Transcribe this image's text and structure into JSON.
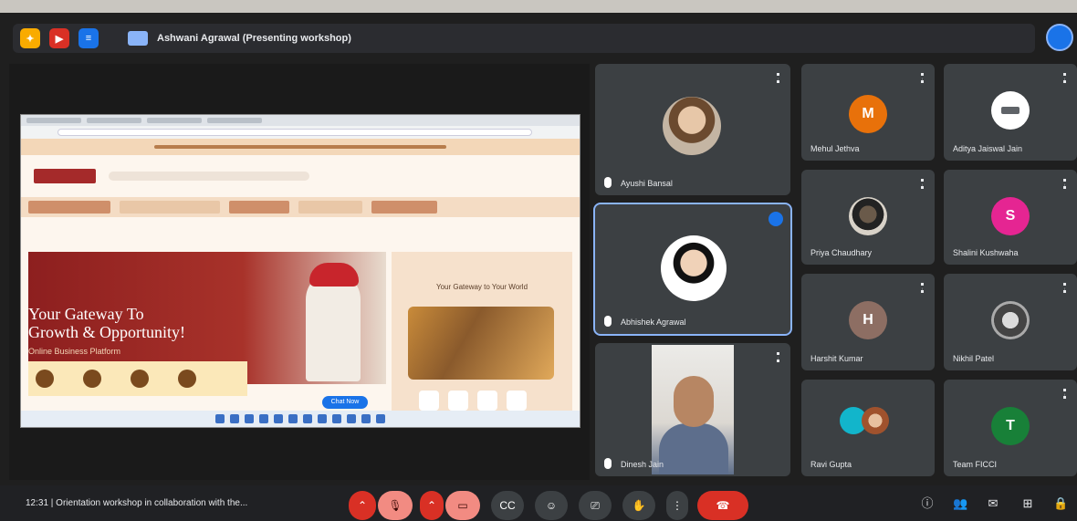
{
  "presenter_bar": {
    "text": "Ashwani Agrawal (Presenting workshop)"
  },
  "shared_screen": {
    "hero_title_line1": "Your Gateway To",
    "hero_title_line2": "Growth & Opportunity!",
    "hero_subtitle": "Online Business Platform",
    "side_title": "Your Gateway to Your World",
    "chat_label": "Chat Now"
  },
  "participants": [
    {
      "name": "Ayushi Bansal",
      "kind": "photo"
    },
    {
      "name": "Abhishek Agrawal",
      "kind": "photo",
      "speaking": true
    },
    {
      "name": "Dinesh Jain",
      "kind": "video"
    },
    {
      "name": "Mehul Jethva",
      "kind": "initial",
      "initial": "M",
      "color": "#e8710a"
    },
    {
      "name": "Aditya Jaiswal Jain",
      "kind": "logo"
    },
    {
      "name": "Priya Chaudhary",
      "kind": "photo"
    },
    {
      "name": "Shalini Kushwaha",
      "kind": "initial",
      "initial": "S",
      "color": "#e52592"
    },
    {
      "name": "Harshit Kumar",
      "kind": "initial",
      "initial": "H",
      "color": "#8d6e63"
    },
    {
      "name": "Nikhil Patel",
      "kind": "photo"
    },
    {
      "name": "Ravi Gupta",
      "kind": "group"
    },
    {
      "name": "Team FICCI",
      "kind": "initial",
      "initial": "T",
      "color": "#188038"
    }
  ],
  "bottom_bar": {
    "meeting_info": "12:31 | Orientation workshop in collaboration with the...",
    "end_call_icon": "phone-hangup-icon"
  },
  "colors": {
    "accent": "#8ab4f8",
    "end_call": "#d93025",
    "tile_bg": "#3c4043"
  }
}
